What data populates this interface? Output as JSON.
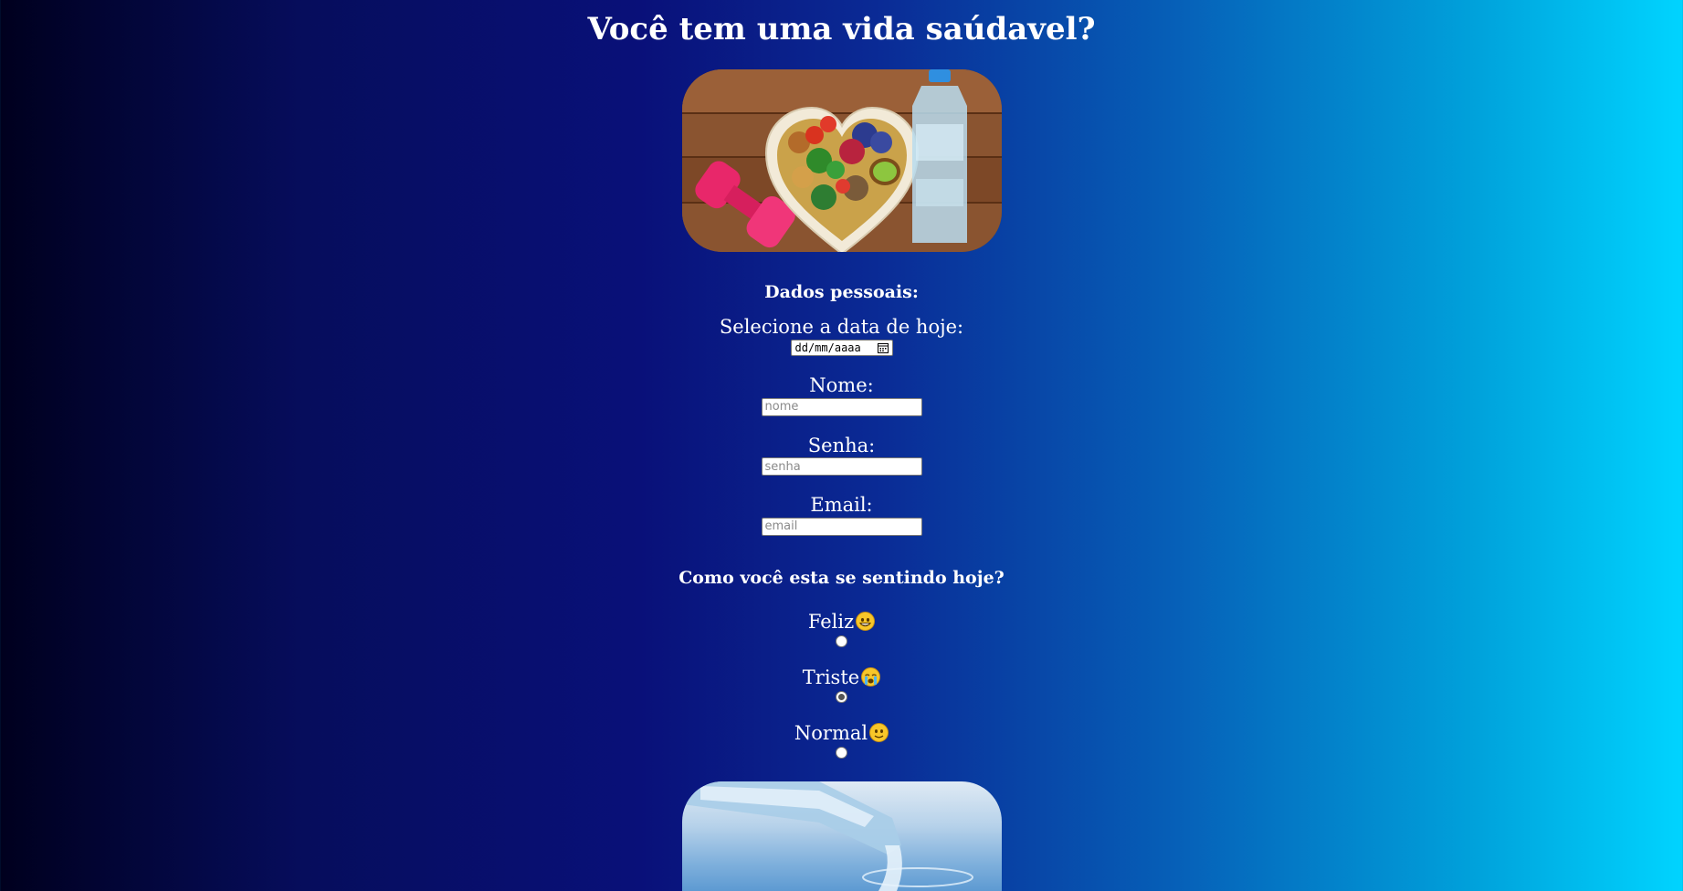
{
  "page": {
    "title": "Você tem uma vida saúdavel?"
  },
  "images": {
    "hero_top": "healthy-food-heart-dumbbell-water-image",
    "hero_bottom": "water-bottle-pouring-image"
  },
  "personal": {
    "heading": "Dados pessoais:",
    "date": {
      "label": "Selecione a data de hoje:",
      "placeholder": "dd/mm/aaaa"
    },
    "name": {
      "label": "Nome:",
      "placeholder": "nome",
      "value": ""
    },
    "password": {
      "label": "Senha:",
      "placeholder": "senha",
      "value": ""
    },
    "email": {
      "label": "Email:",
      "placeholder": "email",
      "value": ""
    }
  },
  "mood": {
    "heading": "Como você esta se sentindo hoje?",
    "options": [
      {
        "label": "Feliz",
        "emoji": "grinning-face-icon",
        "checked": false
      },
      {
        "label": "Triste",
        "emoji": "crying-face-icon",
        "checked": true
      },
      {
        "label": "Normal",
        "emoji": "slightly-smiling-face-icon",
        "checked": false
      }
    ]
  },
  "colors": {
    "gradient_left": "#00001e",
    "gradient_mid": "#091079",
    "gradient_right": "#00d4ff",
    "text": "#ffffff"
  }
}
